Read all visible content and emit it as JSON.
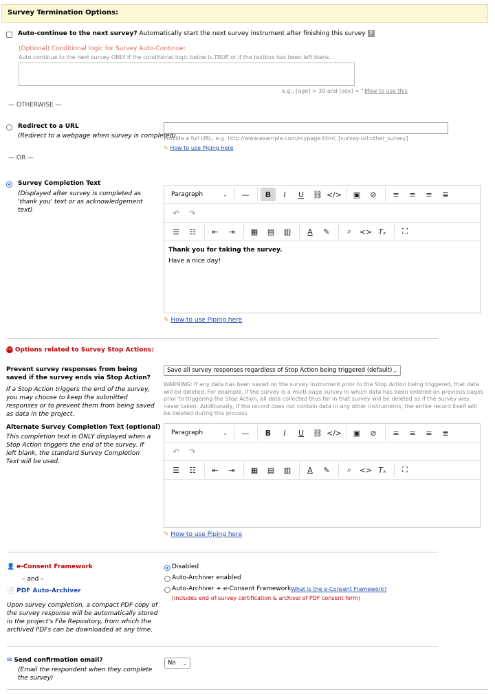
{
  "header": {
    "title": "Survey Termination Options:"
  },
  "auto_continue": {
    "label": "Auto-continue to the next survey?",
    "desc": "Automatically start the next survey instrument after finishing this survey",
    "help_icon": "?",
    "cond_title": "(Optional) Conditional logic for Survey Auto-Continue:",
    "cond_desc_pre": "Auto-continue to the next survey ONLY if the conditional logic below is ",
    "cond_desc_true": "TRUE",
    "cond_desc_post": " or if the textbox has been left blank.",
    "example": "e.g., [age] > 30 and [sex] = \"1\"",
    "how_link": "How to use this"
  },
  "otherwise_label": "— OTHERWISE —",
  "redirect": {
    "title": "Redirect to a URL",
    "desc": "(Redirect to a webpage when survey is completed)",
    "hint": "Provide a full URL, e.g. http://www.example.com/mypage.html, [survey-url:other_survey]",
    "piping_link": "How to use Piping here"
  },
  "or_label": "— OR —",
  "completion": {
    "title": "Survey Completion Text",
    "desc": "(Displayed after survey is completed as 'thank you' text or as acknowledgement text)",
    "editor_line1": "Thank you for taking the survey.",
    "editor_line2": "Have a nice day!",
    "piping_link": "How to use Piping here"
  },
  "editor_toolbar": {
    "block_format": "Paragraph"
  },
  "stop": {
    "section_title": "Options related to Survey Stop Actions:",
    "prevent_title": "Prevent survey responses from being saved if the survey ends via Stop Action?",
    "prevent_desc": "If a Stop Action triggers the end of the survey, you may choose to keep the submitted responses or to prevent them from being saved as data in the project.",
    "select_value": "Save all survey responses regardless of Stop Action being triggered (default)",
    "warning": "WARNING: If any data has been saved on the survey instrument prior to the Stop Action being triggered, that data will be deleted. For example, if the survey is a multi-page survey in which data has been entered on previous pages prior to triggering the Stop Action, all data collected thus far in that survey will be deleted as if the survey was never taken. Additionally, if the record does not contain data in any other instruments, the entire record itself will be deleted during this process.",
    "alt_title": "Alternate Survey Completion Text (optional)",
    "alt_desc": "This completion text is ONLY displayed when a Stop Action triggers the end of the survey. If left blank, the standard Survey Completion Text will be used.",
    "piping_link": "How to use Piping here"
  },
  "econsent": {
    "title": "e-Consent Framework",
    "and_label": "– and –",
    "pdf_title": "PDF Auto-Archiver",
    "desc": "Upon survey completion, a compact PDF copy of the survey response will be automatically stored in the project's File Repository, from which the archived PDFs can be downloaded at any time.",
    "opt1": "Disabled",
    "opt2": "Auto-Archiver enabled",
    "opt3": "Auto-Archiver + e-Consent Framework",
    "what_link": "What is the e-Consent Framework?",
    "note": "(includes end-of-survey certification & archival of PDF consent form)"
  },
  "confirm": {
    "title": "Send confirmation email?",
    "desc": "(Email the respondent when they complete the survey)",
    "select_value": "No"
  },
  "colors": {
    "header_bg": "#fbf8d8",
    "accent_red": "#c00000",
    "link": "#2048a8"
  }
}
